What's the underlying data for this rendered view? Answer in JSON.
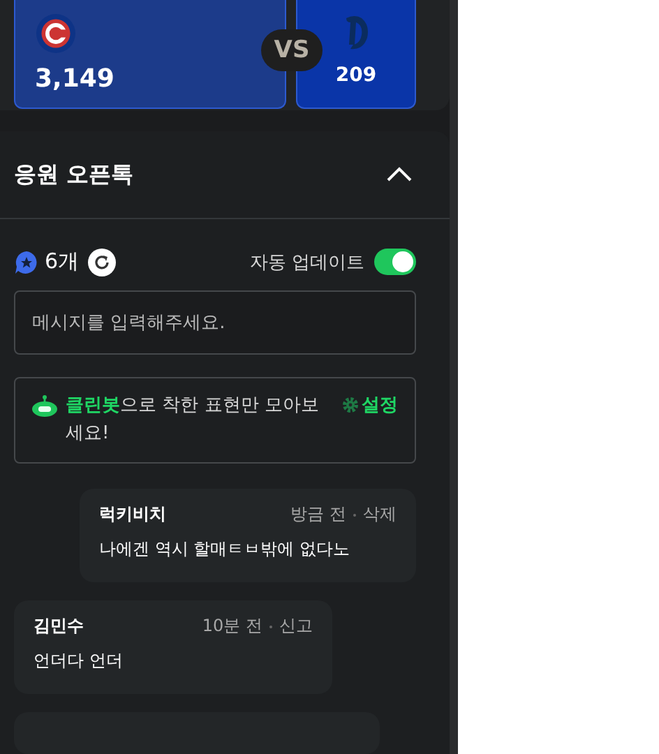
{
  "match": {
    "home": {
      "score": "3,149"
    },
    "vs": "VS",
    "away": {
      "score": "209"
    }
  },
  "chat": {
    "title": "응원 오픈톡",
    "expanded": true,
    "count": "6개",
    "auto_update": {
      "label": "자동 업데이트",
      "on": true
    },
    "input": {
      "placeholder": "메시지를 입력해주세요."
    },
    "notice": {
      "text": "**클린봇**으로 착한 표현만 모아보세요!",
      "settings": "설정"
    },
    "messages": [
      {
        "author": "럭키비치",
        "time": "방금 전",
        "action": "삭제",
        "text": "나에겐 역시 할매ㅌㅂ밖에 없다노",
        "mine": true
      },
      {
        "author": "김민수",
        "time": "10분 전",
        "action": "신고",
        "text": "언더다 언더",
        "mine": false
      }
    ]
  }
}
